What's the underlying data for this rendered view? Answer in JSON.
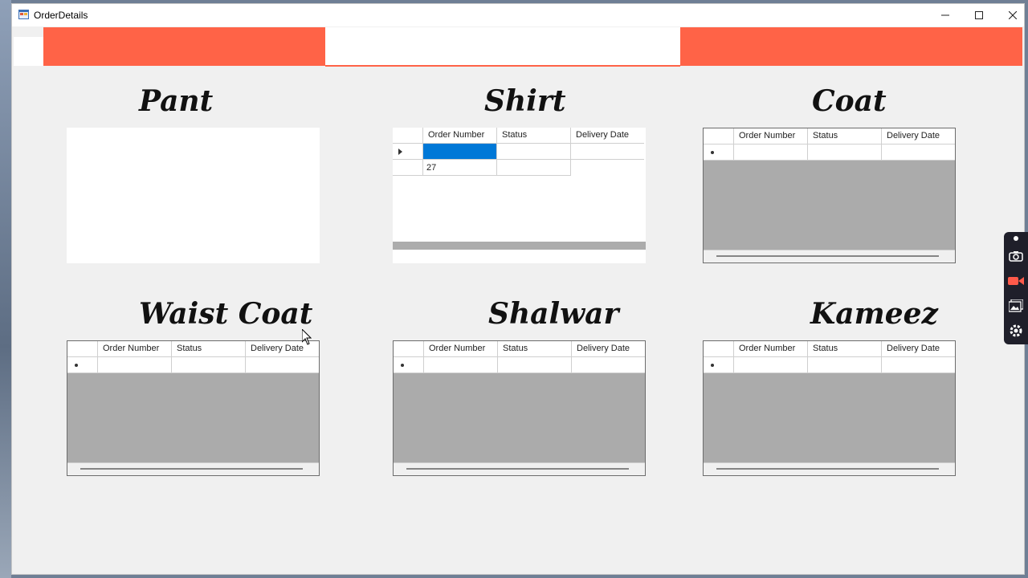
{
  "window": {
    "title": "OrderDetails",
    "minimize_icon": "minimize-icon",
    "maximize_icon": "maximize-icon",
    "close_icon": "close-icon"
  },
  "colors": {
    "banner": "#ff6347",
    "selection": "#0078d7",
    "grid_background": "#ababab",
    "window_background": "#f0f0f0"
  },
  "columns": [
    "Order Number",
    "Status",
    "Delivery Date"
  ],
  "sections": {
    "pant": {
      "heading": "Pant"
    },
    "shirt": {
      "heading": "Shirt",
      "rows": [
        {
          "order_number": "",
          "status": "",
          "delivery_date": ""
        },
        {
          "order_number": "27",
          "status": "",
          "delivery_date": ""
        }
      ]
    },
    "coat": {
      "heading": "Coat"
    },
    "waist_coat": {
      "heading": "Waist Coat"
    },
    "shalwar": {
      "heading": "Shalwar"
    },
    "kameez": {
      "heading": "Kameez"
    }
  },
  "side_toolbar": {
    "icons": [
      "pin-icon",
      "camera-icon",
      "video-icon",
      "gallery-icon",
      "settings-icon"
    ]
  }
}
